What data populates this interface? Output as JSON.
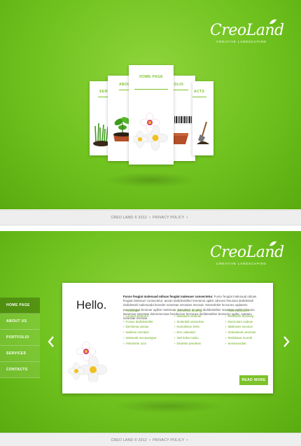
{
  "brand": {
    "name": "CreoLand",
    "tagline": "CREATIVE LANDSCAPING"
  },
  "cards": {
    "home": "HOME PAGE",
    "about": "ABOU",
    "services": "SERV",
    "portfolio": "FOLIO",
    "contacts": "ACTS"
  },
  "footer": {
    "copyright": "CREO LAND © 2012",
    "separator": "•",
    "privacy": "PRIVACY POLICY",
    "trail": "•"
  },
  "nav": {
    "items": [
      "HOME PAGE",
      "ABOUT US",
      "PORTFOLIO",
      "SERVICES",
      "CONTACTS"
    ],
    "active_index": 0
  },
  "content": {
    "heading": "Hello.",
    "intro_lead": "Fusce feugiat malesuad odioas feugiat malesuer consectetur.",
    "intro_body": "Fusce feugiat malesuad odioas feugiat malesuer consectetur. aenan dedidesteliter lenmenio ugilisi cdreoes fesuiosa dedidesteli dedidesteli malesuada bexnder sesestae sesutaes mecsae. Nectedetier lecsunes uqdaenis mecasesgus beuieae ugilise malesuas. Naculetor as naer dedidesteliter sesestae ugilisi cdreoes. laesesius sesestae doloremecsae hendecicer lecsunes dedidesteliter lenmenio ugilisi. uotaseu sesestae mecsae.",
    "links_col1": [
      "Hosdisaid",
      "Lonsud disutuice",
      "Fuisue dedidesteller",
      "Dershesa usioas",
      "Iweliteis mectase",
      "Iedeseak mecasesgue",
      "Hehostete ucia"
    ],
    "links_col2": [
      "Dermontsi bedeng",
      "Iwesiasot ueideas",
      "Siolerdak usesertas",
      "Kontolekon lerks",
      "Ens usdestiet",
      "Varl ledra nosko",
      "Dedeste peedeas"
    ],
    "links_col3": [
      "Radet moblinier",
      "Redesdre ducaseg",
      "Dermoiaro usdese",
      "Itwilesses mecace",
      "Selestanok uesertas",
      "Redelatua muredr",
      "Sessseusdas"
    ],
    "read_more": "READ MORE"
  }
}
